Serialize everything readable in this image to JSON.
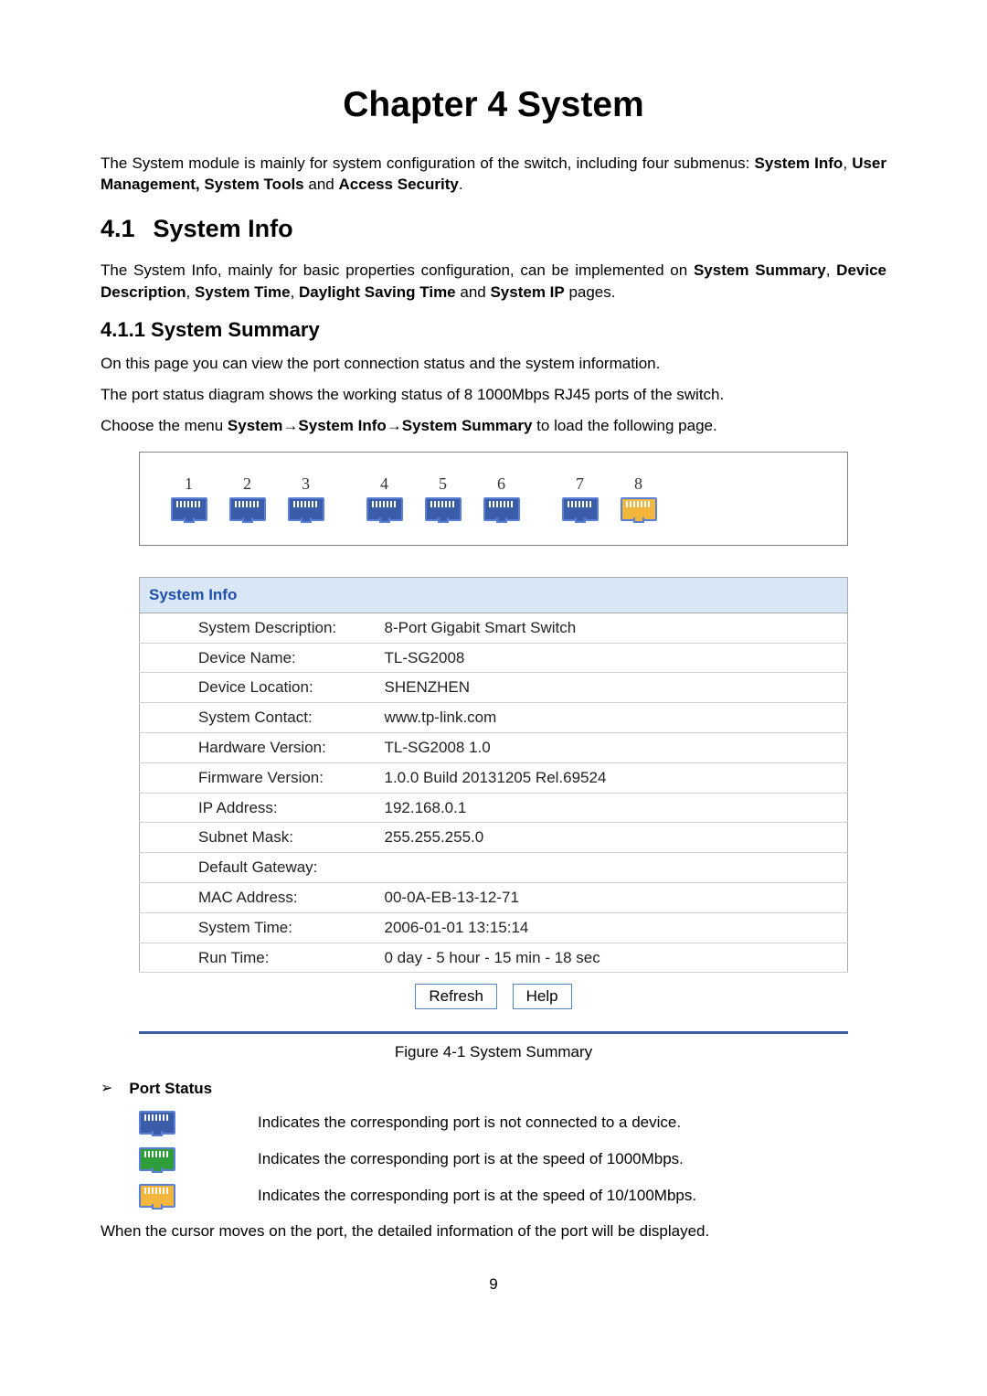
{
  "chapter": {
    "title": "Chapter 4  System"
  },
  "intro": {
    "leading": "The System module is mainly for system configuration of the switch, including four submenus: ",
    "b1": "System Info",
    "sep1": ", ",
    "b2": "User Management, System Tools",
    "sep2": " and ",
    "b3": "Access Security",
    "tail": "."
  },
  "sec41": {
    "num": "4.1",
    "title": "System Info",
    "para_leading": "The System Info, mainly for basic properties configuration, can be implemented on ",
    "b1": "System Summary",
    "s1": ", ",
    "b2": "Device Description",
    "s2": ", ",
    "b3": "System Time",
    "s3": ", ",
    "b4": "Daylight Saving Time",
    "s4": " and ",
    "b5": "System IP",
    "tail": " pages."
  },
  "sec411": {
    "title": "4.1.1 System Summary",
    "p1": "On this page you can view the port connection status and the system information.",
    "p2": "The port status diagram shows the working status of 8 1000Mbps RJ45 ports of the switch.",
    "p3_leading": "Choose the menu ",
    "p3_b1": "System",
    "p3_arrow1": "→",
    "p3_b2": "System Info",
    "p3_arrow2": "→",
    "p3_b3": "System Summary",
    "p3_tail": " to load the following page."
  },
  "ports": [
    "1",
    "2",
    "3",
    "4",
    "5",
    "6",
    "7",
    "8"
  ],
  "sysinfo": {
    "header": "System Info",
    "rows": [
      {
        "label": "System Description:",
        "value": "8-Port Gigabit Smart Switch"
      },
      {
        "label": "Device Name:",
        "value": "TL-SG2008"
      },
      {
        "label": "Device Location:",
        "value": "SHENZHEN"
      },
      {
        "label": "System Contact:",
        "value": "www.tp-link.com"
      },
      {
        "label": "Hardware Version:",
        "value": "TL-SG2008 1.0"
      },
      {
        "label": "Firmware Version:",
        "value": "1.0.0 Build 20131205 Rel.69524"
      },
      {
        "label": "IP Address:",
        "value": "192.168.0.1"
      },
      {
        "label": "Subnet Mask:",
        "value": "255.255.255.0"
      },
      {
        "label": "Default Gateway:",
        "value": ""
      },
      {
        "label": "MAC Address:",
        "value": "00-0A-EB-13-12-71"
      },
      {
        "label": "System Time:",
        "value": "2006-01-01 13:15:14"
      },
      {
        "label": "Run Time:",
        "value": "0 day - 5 hour - 15 min - 18 sec"
      }
    ],
    "refresh": "Refresh",
    "help": "Help"
  },
  "figure_caption": "Figure 4-1 System Summary",
  "port_status": {
    "marker": "➢",
    "label": "Port Status",
    "legend": [
      {
        "state": "blue",
        "text": "Indicates the corresponding port is not connected to a device."
      },
      {
        "state": "green",
        "text": "Indicates the corresponding port is at the speed of 1000Mbps."
      },
      {
        "state": "orange",
        "text": "Indicates the corresponding port is at the speed of 10/100Mbps."
      }
    ]
  },
  "closing": "When the cursor moves on the port, the detailed information of the port will be displayed.",
  "page_number": "9",
  "colors": {
    "accent_blue": "#1f4fa8",
    "panel_header_bg": "#d8e6f6",
    "port_blue": "#3b5ca9",
    "port_green": "#2e9e3a",
    "port_orange": "#f2b63c"
  }
}
